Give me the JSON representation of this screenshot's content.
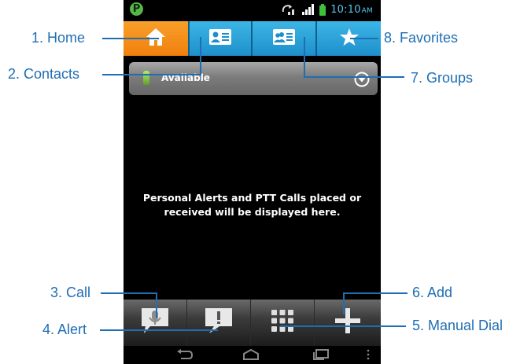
{
  "status_bar": {
    "app_badge": "P",
    "time": "10:10",
    "ampm": "AM",
    "icons": [
      "ptt-app-icon",
      "sync-icon",
      "signal-icon",
      "battery-icon"
    ]
  },
  "tabs": [
    {
      "icon": "home-icon",
      "active": true
    },
    {
      "icon": "contact-card-icon",
      "active": false
    },
    {
      "icon": "group-card-icon",
      "active": false
    },
    {
      "icon": "star-icon",
      "active": false
    }
  ],
  "availability": {
    "label": "Available",
    "dropdown_icon": "chevron-down-circle-icon"
  },
  "empty_message": {
    "line1": "Personal Alerts and PTT Calls placed or",
    "line2": "received will be displayed here."
  },
  "bottom_actions": [
    {
      "icon": "microphone-bubble-icon"
    },
    {
      "icon": "alert-bubble-icon"
    },
    {
      "icon": "keypad-icon"
    },
    {
      "icon": "plus-icon"
    }
  ],
  "nav_icons": [
    "back-icon",
    "home-nav-icon",
    "recents-icon",
    "menu-dots-icon"
  ],
  "callouts": {
    "home": "1. Home",
    "contacts": "2. Contacts",
    "call": "3. Call",
    "alert": "4. Alert",
    "manual_dial": "5. Manual Dial",
    "add": "6. Add",
    "groups": "7. Groups",
    "favorites": "8. Favorites"
  },
  "colors": {
    "home_tab": "#f28a18",
    "blue_tab": "#2aa2d8",
    "callout": "#1f6eb3",
    "clock": "#55c7f0",
    "available_led": "#8fd44a"
  }
}
